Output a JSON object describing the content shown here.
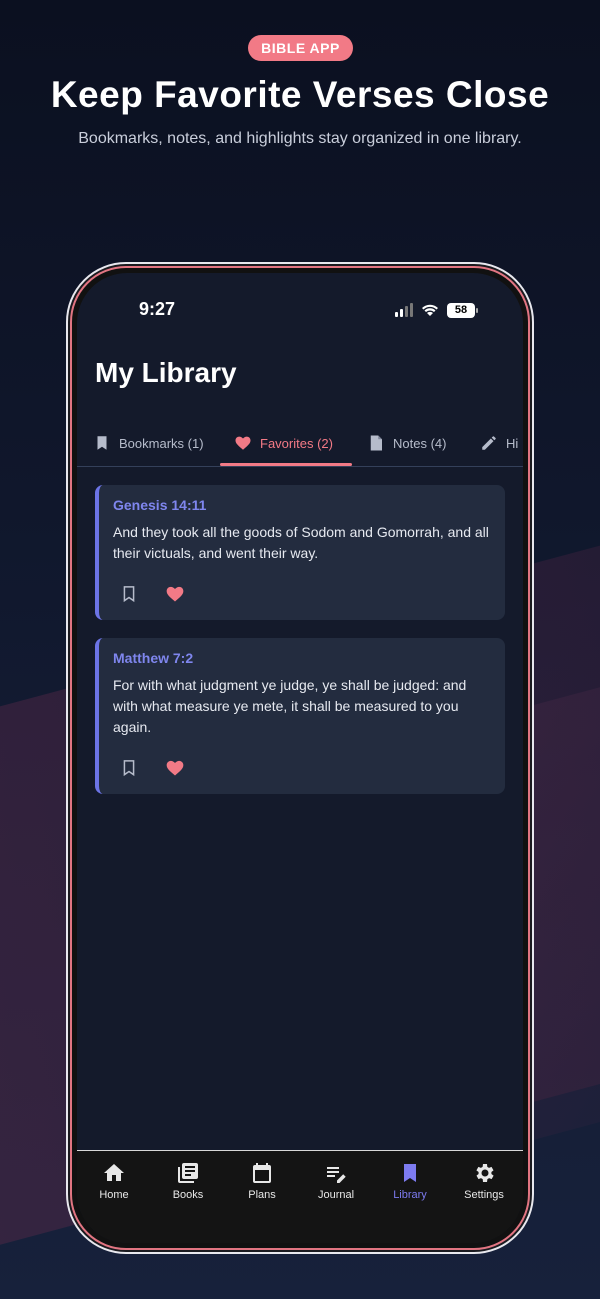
{
  "promo": {
    "badge": "BIBLE APP",
    "headline": "Keep Favorite Verses Close",
    "subhead": "Bookmarks, notes, and highlights stay organized in one library."
  },
  "status_bar": {
    "time": "9:27",
    "battery": "58"
  },
  "page": {
    "title": "My Library"
  },
  "tabs": [
    {
      "label": "Bookmarks (1)",
      "icon": "bookmark-icon"
    },
    {
      "label": "Favorites (2)",
      "icon": "heart-icon",
      "active": true
    },
    {
      "label": "Notes (4)",
      "icon": "note-icon"
    },
    {
      "label": "Hi",
      "icon": "pencil-icon"
    }
  ],
  "cards": [
    {
      "reference": "Genesis 14:11",
      "text": "And they took all the goods of Sodom and Gomorrah, and all their victuals, and went their way."
    },
    {
      "reference": "Matthew 7:2",
      "text": "For with what judgment ye judge, ye shall be judged: and with what measure ye mete, it shall be measured to you again."
    }
  ],
  "bottom_nav": [
    {
      "label": "Home",
      "icon": "home-icon"
    },
    {
      "label": "Books",
      "icon": "books-icon"
    },
    {
      "label": "Plans",
      "icon": "calendar-icon"
    },
    {
      "label": "Journal",
      "icon": "journal-icon"
    },
    {
      "label": "Library",
      "icon": "bookmark-icon",
      "active": true
    },
    {
      "label": "Settings",
      "icon": "gear-icon"
    }
  ],
  "colors": {
    "accent": "#f27a86",
    "primary": "#7d7bf0",
    "card_bg": "#232c3f",
    "screen_bg": "#141a2b"
  }
}
